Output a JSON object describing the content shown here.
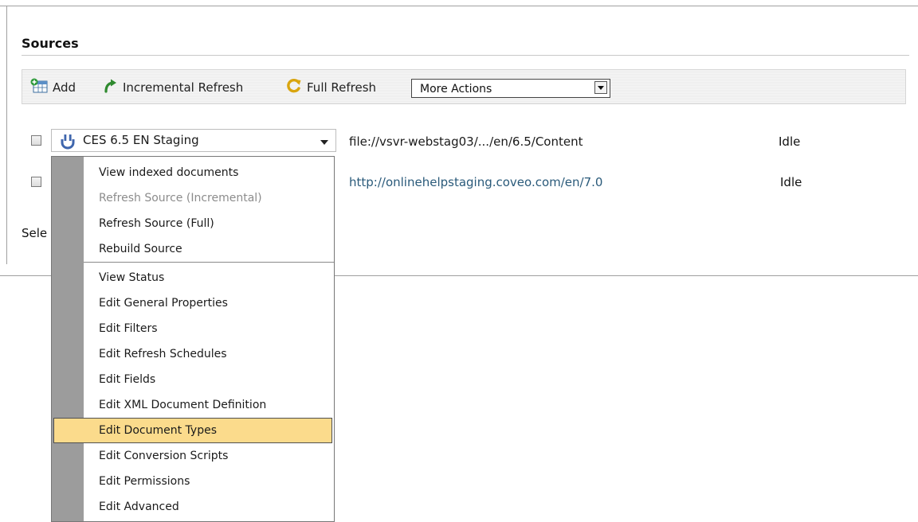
{
  "section": {
    "title": "Sources"
  },
  "toolbar": {
    "add_label": "Add",
    "incremental_refresh_label": "Incremental Refresh",
    "full_refresh_label": "Full Refresh",
    "more_actions_value": "More Actions"
  },
  "rows": [
    {
      "source_name": "CES 6.5 EN Staging",
      "path": "file://vsvr-webstag03/.../en/6.5/Content",
      "status": "Idle"
    },
    {
      "path": "http://onlinehelpstaging.coveo.com/en/7.0",
      "status": "Idle"
    }
  ],
  "footer": {
    "select_text": "Sele"
  },
  "menu": {
    "items": [
      "View indexed documents",
      "Refresh Source (Incremental)",
      "Refresh Source (Full)",
      "Rebuild Source",
      "View Status",
      "Edit General Properties",
      "Edit Filters",
      "Edit Refresh Schedules",
      "Edit Fields",
      "Edit XML Document Definition",
      "Edit Document Types",
      "Edit Conversion Scripts",
      "Edit Permissions",
      "Edit Advanced"
    ]
  },
  "colors": {
    "menu_highlight": "#fbdb8c",
    "link_color": "#2a5a7a",
    "disabled_text": "#8c8c8c"
  },
  "icons": {
    "add": "add-table-icon",
    "incremental_refresh": "green-refresh-arrow-icon",
    "full_refresh": "yellow-refresh-icon",
    "source": "plug-icon"
  }
}
